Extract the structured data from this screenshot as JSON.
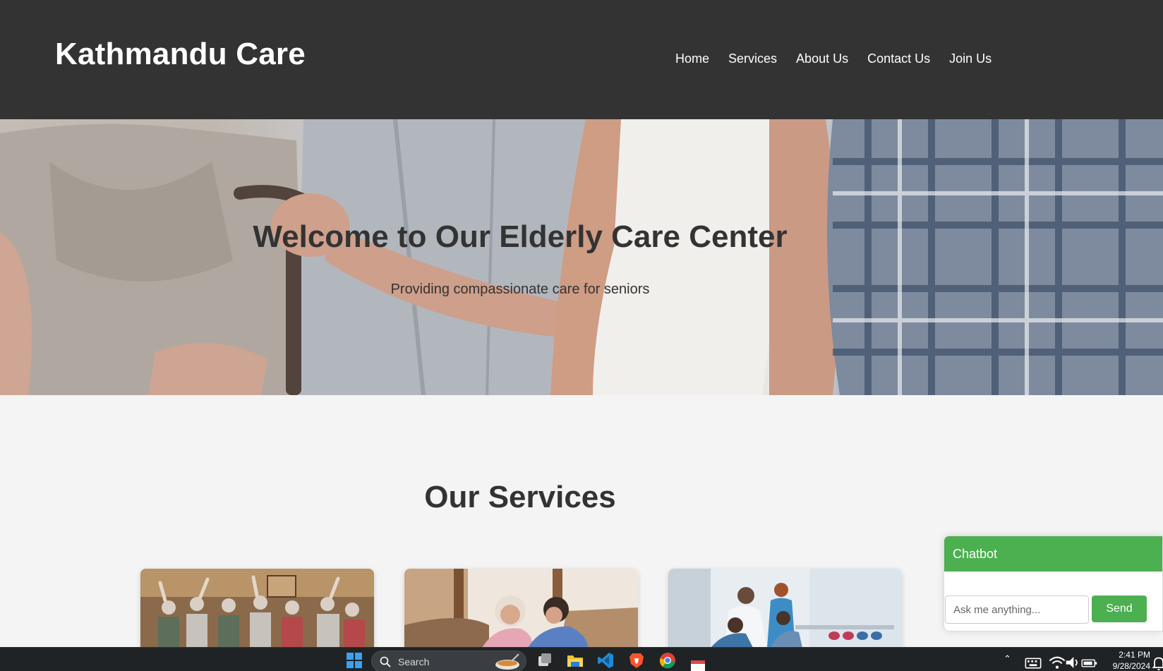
{
  "header": {
    "logo": "Kathmandu Care",
    "nav": [
      "Home",
      "Services",
      "About Us",
      "Contact Us",
      "Join Us"
    ]
  },
  "hero": {
    "title": "Welcome to Our Elderly Care Center",
    "subtitle": "Providing compassionate care for seniors"
  },
  "services": {
    "title": "Our Services",
    "cards": [
      {
        "image": "group-activity-photo"
      },
      {
        "image": "caregiver-photo"
      },
      {
        "image": "physiotherapy-photo"
      }
    ]
  },
  "chatbot": {
    "title": "Chatbot",
    "input_placeholder": "Ask me anything...",
    "send_label": "Send"
  },
  "taskbar": {
    "search_label": "Search",
    "time": "2:41 PM",
    "date": "9/28/2024"
  },
  "colors": {
    "header_bg": "#333333",
    "page_bg": "#f4f4f4",
    "accent_green": "#4caf50",
    "taskbar_bg": "#1f2326"
  },
  "icons": [
    "windows-start-icon",
    "search-icon",
    "task-view-icon",
    "file-explorer-icon",
    "vscode-icon",
    "brave-icon",
    "chrome-icon",
    "calendar-app-icon",
    "chevron-up-icon",
    "keyboard-icon",
    "wifi-icon",
    "volume-icon",
    "battery-icon",
    "notification-bell-icon"
  ]
}
